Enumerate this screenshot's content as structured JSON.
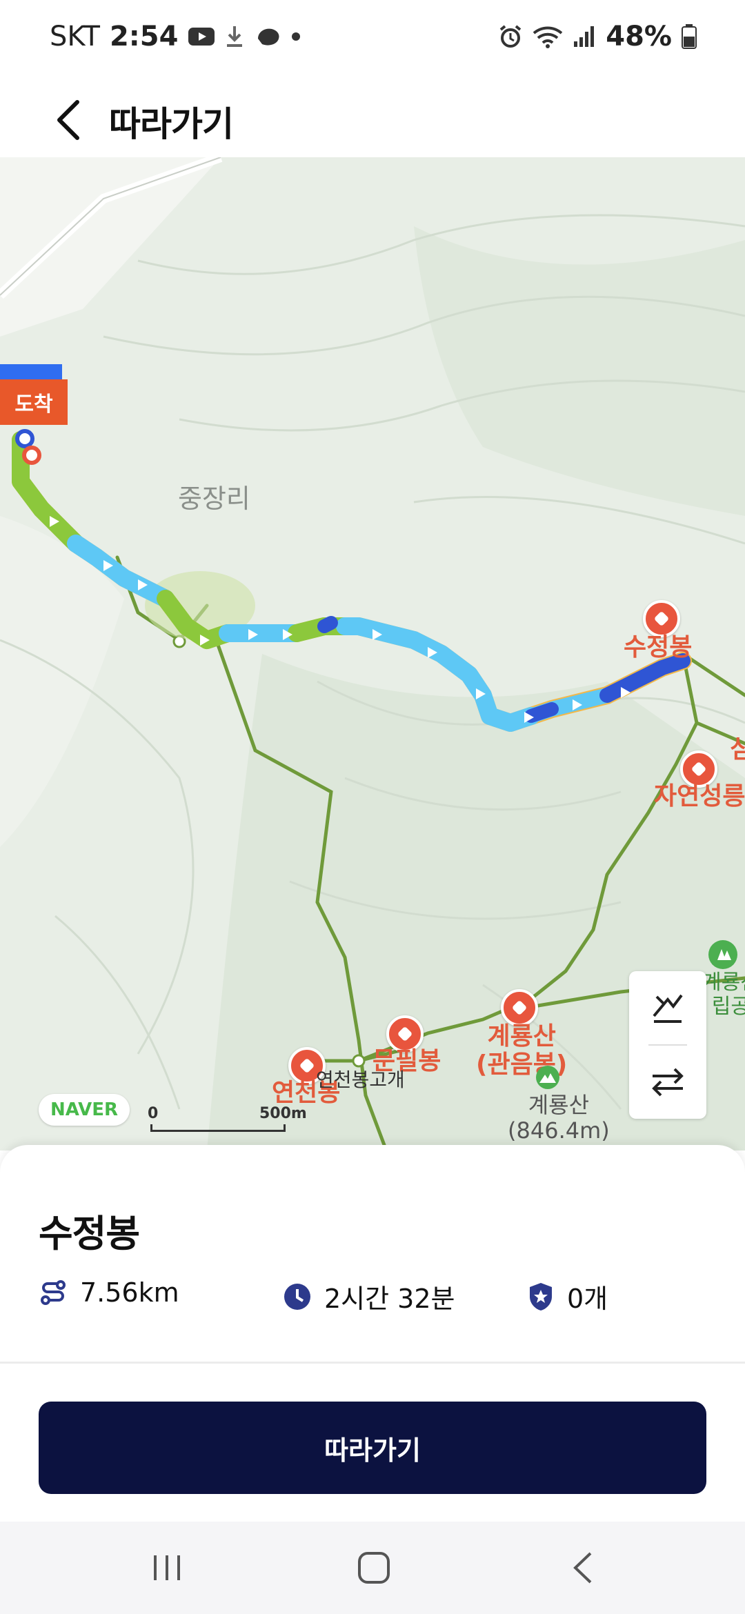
{
  "status_bar": {
    "carrier": "SKT",
    "time": "2:54",
    "battery": "48%"
  },
  "header": {
    "title": "따라가기",
    "back_icon": "chevron-left-icon"
  },
  "map": {
    "provider_logo": "NAVER",
    "scale_zero": "0",
    "scale_label": "500m",
    "arrival_flag": "도착",
    "village_label": "중장리",
    "places": {
      "sujeongbong": "수정봉",
      "jayeonseongneung": "자연성릉",
      "gyeryongsan_gwaneumbong": "계룡산\n(관음봉)",
      "munpilbong": "문필봉",
      "yeoncheonbong": "연천봉",
      "yeoncheonbong_gogae": "연천봉고개",
      "gyeryongsan_peak": "계룡산\n(846.4m)",
      "sim_partial": "심",
      "park_partial": "계룡산\n립공"
    },
    "colors": {
      "route_light_blue": "#5ec8f5",
      "route_green": "#8cc83c",
      "route_dark_blue": "#2f55d4",
      "trail": "#6f9a3a",
      "poi_red": "#e8553d"
    },
    "controls": [
      {
        "icon": "elevation-graph-icon"
      },
      {
        "icon": "swap-direction-icon"
      }
    ]
  },
  "summary": {
    "title": "수정봉",
    "distance": "7.56km",
    "duration": "2시간 32분",
    "badges": "0개"
  },
  "cta_label": "따라가기"
}
